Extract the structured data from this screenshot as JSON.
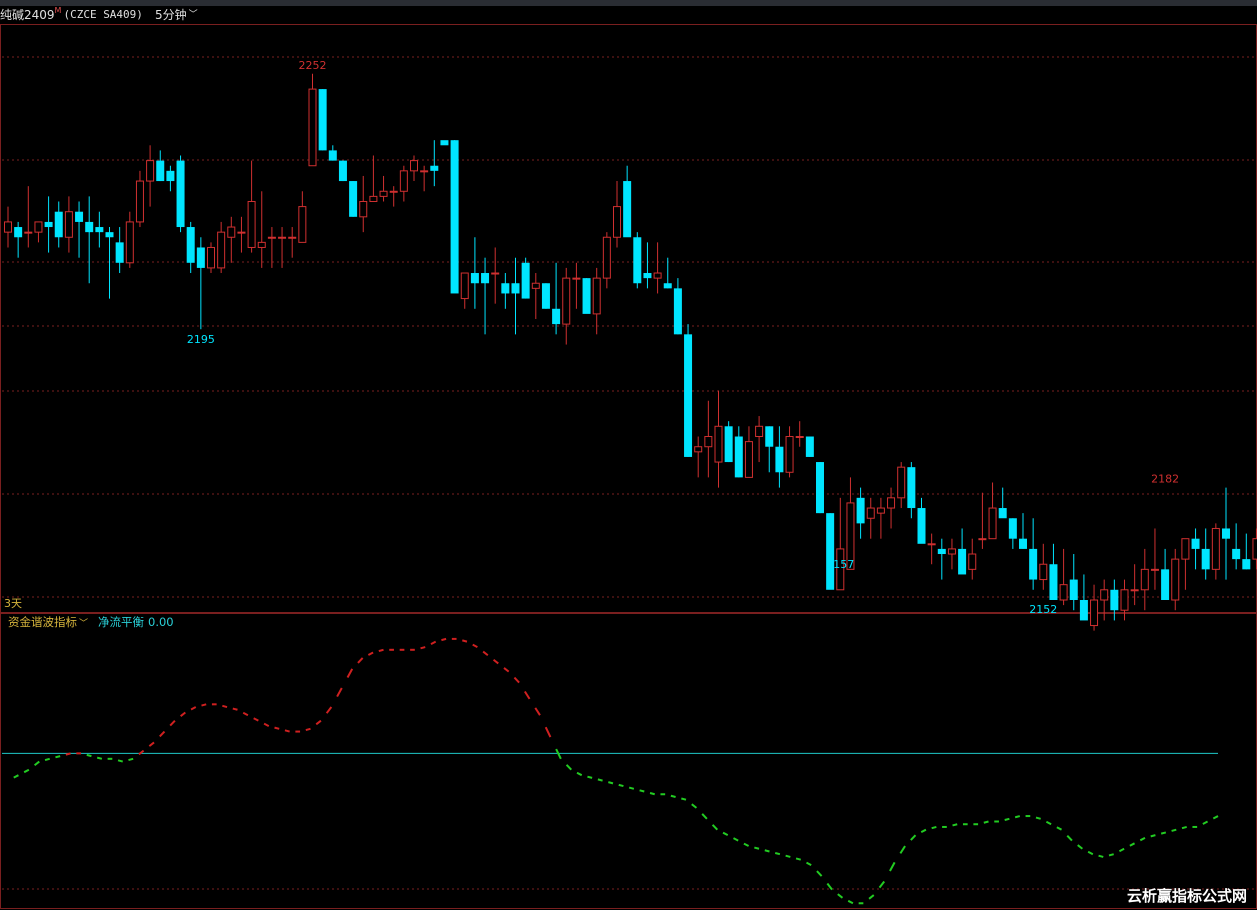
{
  "header": {
    "symbol_name": "纯碱2409",
    "symbol_flag": "M",
    "symbol_code": "(CZCE SA409)",
    "period": "5分钟"
  },
  "main_chart": {
    "price_range": [
      2148,
      2258
    ],
    "high_label": "2252",
    "local_low_label": "2195",
    "low_label_1": "2157",
    "low_label_2": "2152",
    "right_high_label": "2182",
    "days_label": "3天",
    "up_color": "#d03030",
    "down_color": "#00e5ff",
    "candles": [
      [
        2220,
        2225,
        2217,
        2222
      ],
      [
        2221,
        2222,
        2215,
        2219
      ],
      [
        2220,
        2229,
        2217,
        2220
      ],
      [
        2220,
        2222,
        2218,
        2222
      ],
      [
        2222,
        2227,
        2216,
        2221
      ],
      [
        2224,
        2226,
        2217,
        2219
      ],
      [
        2219,
        2227,
        2216,
        2224
      ],
      [
        2224,
        2226,
        2215,
        2222
      ],
      [
        2222,
        2227,
        2210,
        2220
      ],
      [
        2221,
        2224,
        2217,
        2220
      ],
      [
        2220,
        2221,
        2207,
        2219
      ],
      [
        2218,
        2221,
        2212,
        2214
      ],
      [
        2214,
        2224,
        2213,
        2222
      ],
      [
        2222,
        2232,
        2221,
        2230
      ],
      [
        2230,
        2237,
        2225,
        2234
      ],
      [
        2234,
        2236,
        2230,
        2230
      ],
      [
        2232,
        2233,
        2228,
        2230
      ],
      [
        2234,
        2235,
        2220,
        2221
      ],
      [
        2221,
        2222,
        2212,
        2214
      ],
      [
        2217,
        2219,
        2201,
        2213
      ],
      [
        2213,
        2218,
        2212,
        2217
      ],
      [
        2213,
        2222,
        2212,
        2220
      ],
      [
        2219,
        2223,
        2214,
        2221
      ],
      [
        2220,
        2223,
        2216,
        2220
      ],
      [
        2217,
        2234,
        2216,
        2226
      ],
      [
        2217,
        2228,
        2213,
        2218
      ],
      [
        2219,
        2221,
        2213,
        2219
      ],
      [
        2219,
        2221,
        2213,
        2219
      ],
      [
        2219,
        2221,
        2215,
        2219
      ],
      [
        2218,
        2228,
        2218,
        2225
      ],
      [
        2233,
        2251,
        2233,
        2248
      ],
      [
        2248,
        2248,
        2236,
        2236
      ],
      [
        2236,
        2237,
        2234,
        2234
      ],
      [
        2234,
        2234,
        2230,
        2230
      ],
      [
        2230,
        2230,
        2223,
        2223
      ],
      [
        2223,
        2231,
        2220,
        2226
      ],
      [
        2226,
        2235,
        2227,
        2227
      ],
      [
        2227,
        2231,
        2226,
        2228
      ],
      [
        2228,
        2229,
        2225,
        2228
      ],
      [
        2228,
        2233,
        2226,
        2232
      ],
      [
        2232,
        2235,
        2230,
        2234
      ],
      [
        2232,
        2233,
        2228,
        2232
      ],
      [
        2233,
        2238,
        2229,
        2232
      ],
      [
        2238,
        2236,
        2236,
        2237
      ],
      [
        2238,
        2238,
        2210,
        2208
      ],
      [
        2207,
        2210,
        2205,
        2212
      ],
      [
        2212,
        2219,
        2205,
        2210
      ],
      [
        2212,
        2215,
        2200,
        2210
      ],
      [
        2212,
        2217,
        2206,
        2212
      ],
      [
        2210,
        2212,
        2205,
        2208
      ],
      [
        2210,
        2215,
        2200,
        2208
      ],
      [
        2214,
        2215,
        2207,
        2207
      ],
      [
        2209,
        2212,
        2203,
        2210
      ],
      [
        2210,
        2210,
        2205,
        2205
      ],
      [
        2205,
        2214,
        2200,
        2202
      ],
      [
        2202,
        2213,
        2198,
        2211
      ],
      [
        2211,
        2214,
        2205,
        2211
      ],
      [
        2211,
        2211,
        2205,
        2204
      ],
      [
        2204,
        2213,
        2200,
        2211
      ],
      [
        2211,
        2220,
        2209,
        2219
      ],
      [
        2219,
        2230,
        2217,
        2225
      ],
      [
        2230,
        2233,
        2224,
        2219
      ],
      [
        2219,
        2220,
        2209,
        2210
      ],
      [
        2212,
        2218,
        2209,
        2211
      ],
      [
        2211,
        2218,
        2208,
        2212
      ],
      [
        2210,
        2215,
        2209,
        2209
      ],
      [
        2209,
        2211,
        2200,
        2200
      ],
      [
        2200,
        2202,
        2176,
        2176
      ],
      [
        2177,
        2180,
        2172,
        2178
      ],
      [
        2178,
        2187,
        2172,
        2180
      ],
      [
        2175,
        2189,
        2170,
        2182
      ],
      [
        2182,
        2183,
        2175,
        2175
      ],
      [
        2180,
        2182,
        2172,
        2172
      ],
      [
        2172,
        2182,
        2172,
        2179
      ],
      [
        2180,
        2184,
        2175,
        2182
      ],
      [
        2182,
        2182,
        2173,
        2178
      ],
      [
        2178,
        2182,
        2170,
        2173
      ],
      [
        2173,
        2182,
        2172,
        2180
      ],
      [
        2180,
        2183,
        2178,
        2180
      ],
      [
        2180,
        2180,
        2176,
        2176
      ],
      [
        2175,
        2175,
        2165,
        2165
      ],
      [
        2165,
        2165,
        2157,
        2150
      ],
      [
        2150,
        2168,
        2153,
        2158
      ],
      [
        2154,
        2172,
        2154,
        2167
      ],
      [
        2168,
        2170,
        2160,
        2163
      ],
      [
        2164,
        2168,
        2160,
        2166
      ],
      [
        2165,
        2168,
        2160,
        2166
      ],
      [
        2166,
        2170,
        2162,
        2168
      ],
      [
        2168,
        2175,
        2166,
        2174
      ],
      [
        2174,
        2175,
        2164,
        2166
      ],
      [
        2166,
        2168,
        2160,
        2159
      ],
      [
        2159,
        2161,
        2155,
        2159
      ],
      [
        2158,
        2160,
        2152,
        2157
      ],
      [
        2157,
        2160,
        2154,
        2158
      ],
      [
        2158,
        2162,
        2154,
        2153
      ],
      [
        2154,
        2160,
        2152,
        2157
      ],
      [
        2160,
        2169,
        2158,
        2160
      ],
      [
        2160,
        2171,
        2160,
        2166
      ],
      [
        2166,
        2170,
        2166,
        2164
      ],
      [
        2164,
        2164,
        2158,
        2160
      ],
      [
        2160,
        2165,
        2158,
        2158
      ],
      [
        2158,
        2164,
        2150,
        2152
      ],
      [
        2152,
        2159,
        2150,
        2155
      ],
      [
        2155,
        2159,
        2148,
        2148
      ],
      [
        2148,
        2158,
        2147,
        2151
      ],
      [
        2152,
        2157,
        2146,
        2148
      ],
      [
        2148,
        2153,
        2145,
        2144
      ],
      [
        2143,
        2151,
        2142,
        2148
      ],
      [
        2148,
        2152,
        2144,
        2150
      ],
      [
        2150,
        2152,
        2144,
        2146
      ],
      [
        2146,
        2152,
        2144,
        2150
      ],
      [
        2150,
        2155,
        2147,
        2150
      ],
      [
        2150,
        2158,
        2146,
        2154
      ],
      [
        2154,
        2162,
        2150,
        2154
      ],
      [
        2154,
        2158,
        2150,
        2148
      ],
      [
        2148,
        2158,
        2146,
        2156
      ],
      [
        2156,
        2159,
        2150,
        2160
      ],
      [
        2160,
        2162,
        2154,
        2158
      ],
      [
        2158,
        2162,
        2152,
        2154
      ],
      [
        2154,
        2163,
        2152,
        2162
      ],
      [
        2162,
        2170,
        2152,
        2160
      ],
      [
        2158,
        2163,
        2154,
        2156
      ],
      [
        2156,
        2161,
        2154,
        2154
      ],
      [
        2156,
        2162,
        2154,
        2160
      ],
      [
        2160,
        2164,
        2158,
        2159
      ]
    ]
  },
  "indicator": {
    "name": "资金谐波指标",
    "label": "净流平衡",
    "value": "0.00",
    "range": [
      -0.56,
      0.46
    ],
    "zero_color": "#1ec8c8",
    "pos_color": "#d02020",
    "neg_color": "#22cc22",
    "values": [
      -0.1,
      -0.08,
      -0.06,
      -0.03,
      -0.02,
      -0.01,
      0.0,
      0.0,
      -0.01,
      -0.02,
      -0.02,
      -0.03,
      -0.02,
      0.01,
      0.04,
      0.08,
      0.12,
      0.15,
      0.17,
      0.18,
      0.18,
      0.17,
      0.16,
      0.14,
      0.12,
      0.1,
      0.09,
      0.08,
      0.08,
      0.09,
      0.12,
      0.17,
      0.24,
      0.31,
      0.35,
      0.37,
      0.38,
      0.38,
      0.38,
      0.38,
      0.39,
      0.41,
      0.42,
      0.42,
      0.41,
      0.39,
      0.36,
      0.33,
      0.3,
      0.26,
      0.2,
      0.14,
      0.06,
      -0.02,
      -0.06,
      -0.08,
      -0.09,
      -0.1,
      -0.11,
      -0.12,
      -0.13,
      -0.14,
      -0.15,
      -0.15,
      -0.16,
      -0.17,
      -0.2,
      -0.24,
      -0.28,
      -0.3,
      -0.32,
      -0.34,
      -0.35,
      -0.36,
      -0.37,
      -0.38,
      -0.39,
      -0.41,
      -0.45,
      -0.5,
      -0.53,
      -0.55,
      -0.55,
      -0.52,
      -0.47,
      -0.4,
      -0.34,
      -0.3,
      -0.28,
      -0.27,
      -0.27,
      -0.26,
      -0.26,
      -0.26,
      -0.25,
      -0.25,
      -0.24,
      -0.23,
      -0.23,
      -0.24,
      -0.26,
      -0.28,
      -0.32,
      -0.35,
      -0.37,
      -0.38,
      -0.37,
      -0.35,
      -0.33,
      -0.31,
      -0.3,
      -0.29,
      -0.28,
      -0.27,
      -0.27,
      -0.25,
      -0.23
    ]
  },
  "watermark": "云析赢指标公式网"
}
